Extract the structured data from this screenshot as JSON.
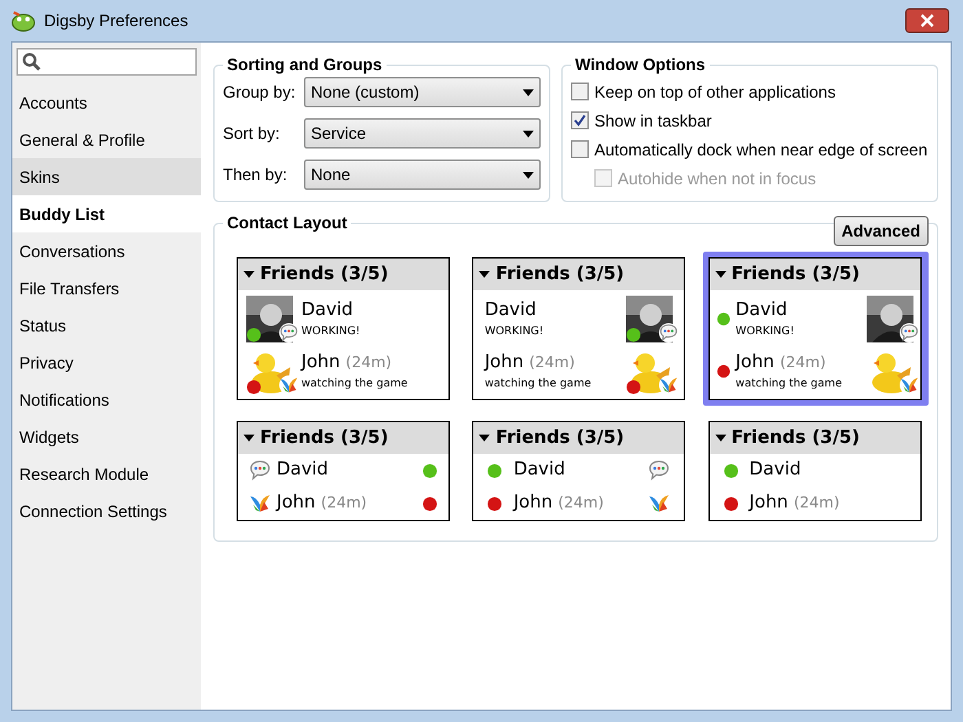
{
  "window": {
    "title": "Digsby Preferences"
  },
  "sidebar": {
    "items": [
      {
        "label": "Accounts",
        "selected": false,
        "hovered": false
      },
      {
        "label": "General & Profile",
        "selected": false,
        "hovered": false
      },
      {
        "label": "Skins",
        "selected": false,
        "hovered": true
      },
      {
        "label": "Buddy List",
        "selected": true,
        "hovered": false
      },
      {
        "label": "Conversations",
        "selected": false,
        "hovered": false
      },
      {
        "label": "File Transfers",
        "selected": false,
        "hovered": false
      },
      {
        "label": "Status",
        "selected": false,
        "hovered": false
      },
      {
        "label": "Privacy",
        "selected": false,
        "hovered": false
      },
      {
        "label": "Notifications",
        "selected": false,
        "hovered": false
      },
      {
        "label": "Widgets",
        "selected": false,
        "hovered": false
      },
      {
        "label": "Research Module",
        "selected": false,
        "hovered": false
      },
      {
        "label": "Connection Settings",
        "selected": false,
        "hovered": false
      }
    ]
  },
  "sorting_and_groups": {
    "title": "Sorting and Groups",
    "fields": [
      {
        "label": "Group by:",
        "value": "None (custom)"
      },
      {
        "label": "Sort by:",
        "value": "Service"
      },
      {
        "label": "Then by:",
        "value": "None"
      }
    ]
  },
  "window_options": {
    "title": "Window Options",
    "options": [
      {
        "label": "Keep on top of other applications",
        "checked": false,
        "disabled": false
      },
      {
        "label": "Show in taskbar",
        "checked": true,
        "disabled": false
      },
      {
        "label": "Automatically dock when near edge of screen",
        "checked": false,
        "disabled": false,
        "children": [
          {
            "label": "Autohide when not in focus",
            "checked": false,
            "disabled": true
          }
        ]
      }
    ]
  },
  "contact_layout": {
    "title": "Contact Layout",
    "advanced_button": "Advanced",
    "layouts": [
      {
        "kind": "avatar-left",
        "selected": false,
        "group": "Friends (3/5)",
        "contacts": [
          {
            "name": "David",
            "message": "WORKING!",
            "kind": "gtalk",
            "color": "#56c01a"
          },
          {
            "name": "John",
            "idle": "(24m)",
            "message": "watching the game",
            "kind": "msn",
            "color": "#d41414"
          }
        ]
      },
      {
        "kind": "avatar-right",
        "selected": false,
        "group": "Friends (3/5)",
        "contacts": [
          {
            "name": "David",
            "message": "WORKING!",
            "kind": "gtalk",
            "color": "#56c01a"
          },
          {
            "name": "John",
            "idle": "(24m)",
            "message": "watching the game",
            "kind": "msn",
            "color": "#d41414"
          }
        ]
      },
      {
        "kind": "status-left",
        "selected": true,
        "group": "Friends (3/5)",
        "contacts": [
          {
            "name": "David",
            "message": "WORKING!",
            "kind": "gtalk",
            "color": "#56c01a"
          },
          {
            "name": "John",
            "idle": "(24m)",
            "message": "watching the game",
            "kind": "msn",
            "color": "#d41414"
          }
        ]
      },
      {
        "kind": "service-left",
        "selected": false,
        "group": "Friends (3/5)",
        "contacts": [
          {
            "name": "David",
            "kind": "gtalk",
            "color": "#56c01a"
          },
          {
            "name": "John",
            "idle": "(24m)",
            "kind": "msn",
            "color": "#d41414"
          }
        ]
      },
      {
        "kind": "service-right",
        "selected": false,
        "group": "Friends (3/5)",
        "contacts": [
          {
            "name": "David",
            "kind": "gtalk",
            "color": "#56c01a"
          },
          {
            "name": "John",
            "idle": "(24m)",
            "kind": "msn",
            "color": "#d41414"
          }
        ]
      },
      {
        "kind": "status-only",
        "selected": false,
        "group": "Friends (3/5)",
        "contacts": [
          {
            "name": "David",
            "color": "#56c01a"
          },
          {
            "name": "John",
            "idle": "(24m)",
            "color": "#d41414"
          }
        ]
      }
    ]
  }
}
